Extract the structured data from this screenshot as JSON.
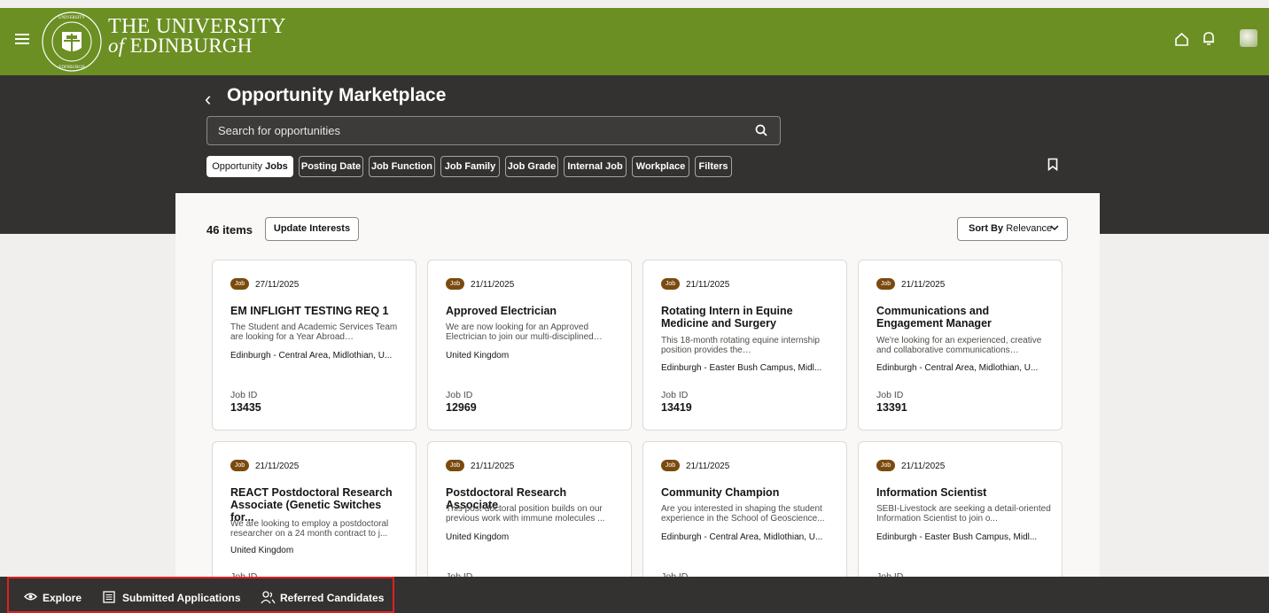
{
  "header": {
    "university_line1": "THE UNIVERSITY",
    "university_of": "of",
    "university_line2": "EDINBURGH",
    "crest_text": "THE UNIVERSITY of EDINBURGH",
    "brand_color": "#6b8f23"
  },
  "page": {
    "title": "Opportunity Marketplace",
    "search_placeholder": "Search for opportunities"
  },
  "filters": [
    {
      "label_prefix": "Opportunity",
      "label": "Jobs",
      "active": true
    },
    {
      "label": "Posting Date"
    },
    {
      "label": "Job Function"
    },
    {
      "label": "Job Family"
    },
    {
      "label": "Job Grade"
    },
    {
      "label": "Internal Job"
    },
    {
      "label": "Workplace"
    },
    {
      "label": "Filters"
    }
  ],
  "results": {
    "count_text": "46 items",
    "update_interests": "Update Interests",
    "sort_prefix": "Sort By",
    "sort_value": "Relevance"
  },
  "cards": [
    {
      "type": "Job",
      "date": "27/11/2025",
      "title": "EM INFLIGHT TESTING REQ 1",
      "description": "The Student and Academic Services Team are looking for a Year Abroad…",
      "location": "Edinburgh - Central Area, Midlothian, U...",
      "job_id_label": "Job ID",
      "job_id": "13435"
    },
    {
      "type": "Job",
      "date": "21/11/2025",
      "title": "Approved Electrician",
      "description": "We are now looking for an Approved Electrician to join our multi-disciplined…",
      "location": "United Kingdom",
      "job_id_label": "Job ID",
      "job_id": "12969"
    },
    {
      "type": "Job",
      "date": "21/11/2025",
      "title": "Rotating Intern in Equine Medicine and Surgery",
      "description": "This 18-month rotating equine internship position provides the…",
      "location": "Edinburgh - Easter Bush Campus, Midl...",
      "job_id_label": "Job ID",
      "job_id": "13419"
    },
    {
      "type": "Job",
      "date": "21/11/2025",
      "title": "Communications and Engagement Manager",
      "description": "We're looking for an experienced, creative and collaborative communications…",
      "location": "Edinburgh - Central Area, Midlothian, U...",
      "job_id_label": "Job ID",
      "job_id": "13391"
    },
    {
      "type": "Job",
      "date": "21/11/2025",
      "title": "REACT Postdoctoral Research Associate (Genetic Switches for...",
      "description": "We are looking to employ a postdoctoral researcher on a 24 month contract to j...",
      "location": "United Kingdom",
      "job_id_label": "Job ID",
      "job_id": ""
    },
    {
      "type": "Job",
      "date": "21/11/2025",
      "title": "Postdoctoral Research Associate",
      "description": "This post-doctoral position builds on our previous work with immune molecules ...",
      "location": "United Kingdom",
      "job_id_label": "Job ID",
      "job_id": ""
    },
    {
      "type": "Job",
      "date": "21/11/2025",
      "title": "Community Champion",
      "description": "Are you interested in shaping the student experience in the School of Geoscience...",
      "location": "Edinburgh - Central Area, Midlothian, U...",
      "job_id_label": "Job ID",
      "job_id": ""
    },
    {
      "type": "Job",
      "date": "21/11/2025",
      "title": "Information Scientist",
      "description": "SEBI-Livestock are seeking a detail-oriented Information Scientist to join o...",
      "location": "Edinburgh - Easter Bush Campus, Midl...",
      "job_id_label": "Job ID",
      "job_id": ""
    }
  ],
  "bottom_nav": {
    "explore": "Explore",
    "submitted": "Submitted Applications",
    "referred": "Referred Candidates"
  }
}
